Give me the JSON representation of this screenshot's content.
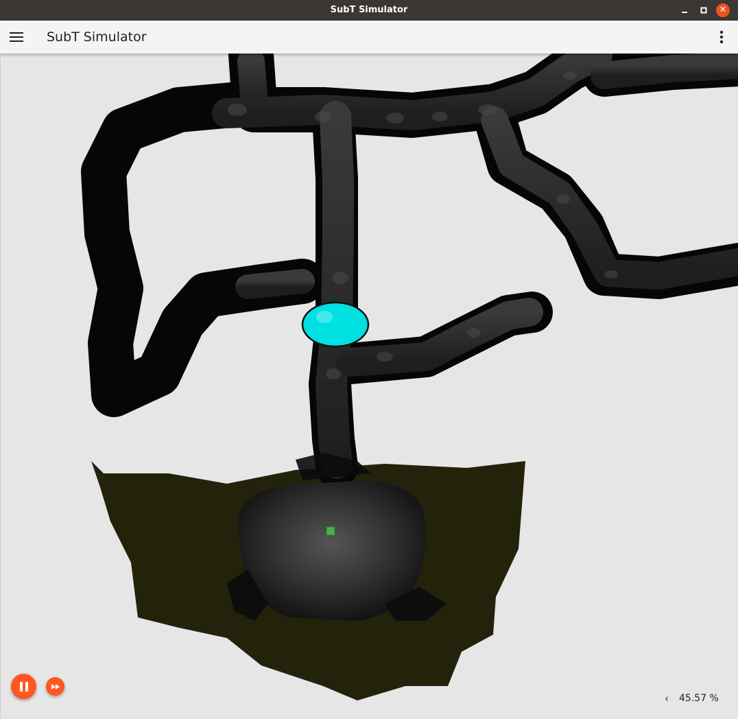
{
  "window": {
    "title": "SubT Simulator",
    "controls": [
      "minimize-icon",
      "maximize-icon",
      "close-icon"
    ],
    "close_glyph": "✕"
  },
  "toolbar": {
    "title": "SubT Simulator",
    "menu_icon": "hamburger-menu-icon",
    "overflow_icon": "more-vert-icon"
  },
  "controls": {
    "pause_icon": "pause-icon",
    "fast_forward_icon": "fast-forward-icon",
    "rtf_chevron": "‹",
    "real_time_factor": "45.57 %"
  },
  "colors": {
    "accent": "#ff5722",
    "close_button": "#e95420",
    "titlebar": "#3a3734",
    "robot_marker": "#00e0e0",
    "tunnel": "#262626",
    "staging_area": "#23230c",
    "background": "#e6e6e6"
  }
}
